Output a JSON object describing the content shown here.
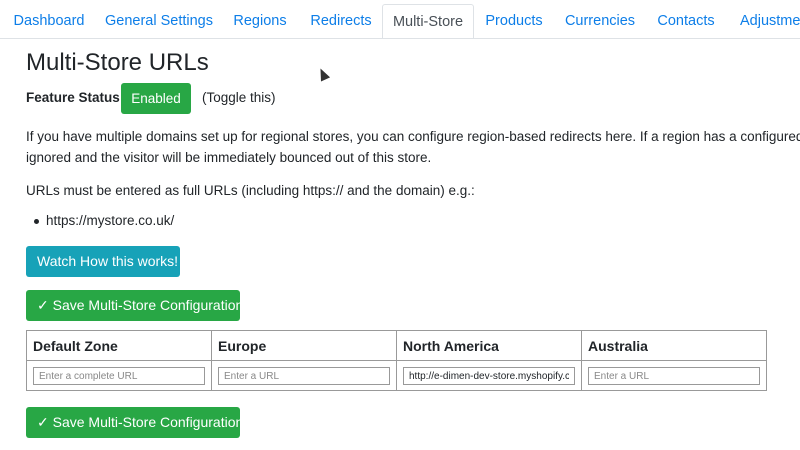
{
  "tabs": [
    {
      "label": "Dashboard"
    },
    {
      "label": "General Settings"
    },
    {
      "label": "Regions"
    },
    {
      "label": "Redirects"
    },
    {
      "label": "Multi-Store"
    },
    {
      "label": "Products"
    },
    {
      "label": "Currencies"
    },
    {
      "label": "Contacts"
    },
    {
      "label": "Adjustmen"
    }
  ],
  "page": {
    "title": "Multi-Store URLs",
    "feature_status_label": "Feature Status",
    "status_value": "Enabled",
    "toggle_hint": "(Toggle this)",
    "description_line1": "If you have multiple domains set up for regional stores, you can configure region-based redirects here. If a region has a configured va",
    "description_line2": "ignored and the visitor will be immediately bounced out of this store.",
    "url_note": "URLs must be entered as full URLs (including https:// and the domain) e.g.:",
    "example_url": "https://mystore.co.uk/"
  },
  "buttons": {
    "watch": "Watch How this works!",
    "save_top": "✓ Save Multi-Store Configuration",
    "save_bottom": "✓ Save Multi-Store Configuration"
  },
  "zones_table": {
    "columns": [
      "Default Zone",
      "Europe",
      "North America",
      "Australia"
    ],
    "inputs": [
      {
        "value": "",
        "placeholder": "Enter a complete URL"
      },
      {
        "value": "",
        "placeholder": "Enter a URL"
      },
      {
        "value": "http://e-dimen-dev-store.myshopify.c",
        "placeholder": "Enter a URL"
      },
      {
        "value": "",
        "placeholder": "Enter a URL"
      }
    ]
  },
  "colors": {
    "link": "#0d7ee8",
    "success": "#28a745",
    "info": "#17a2b8"
  }
}
